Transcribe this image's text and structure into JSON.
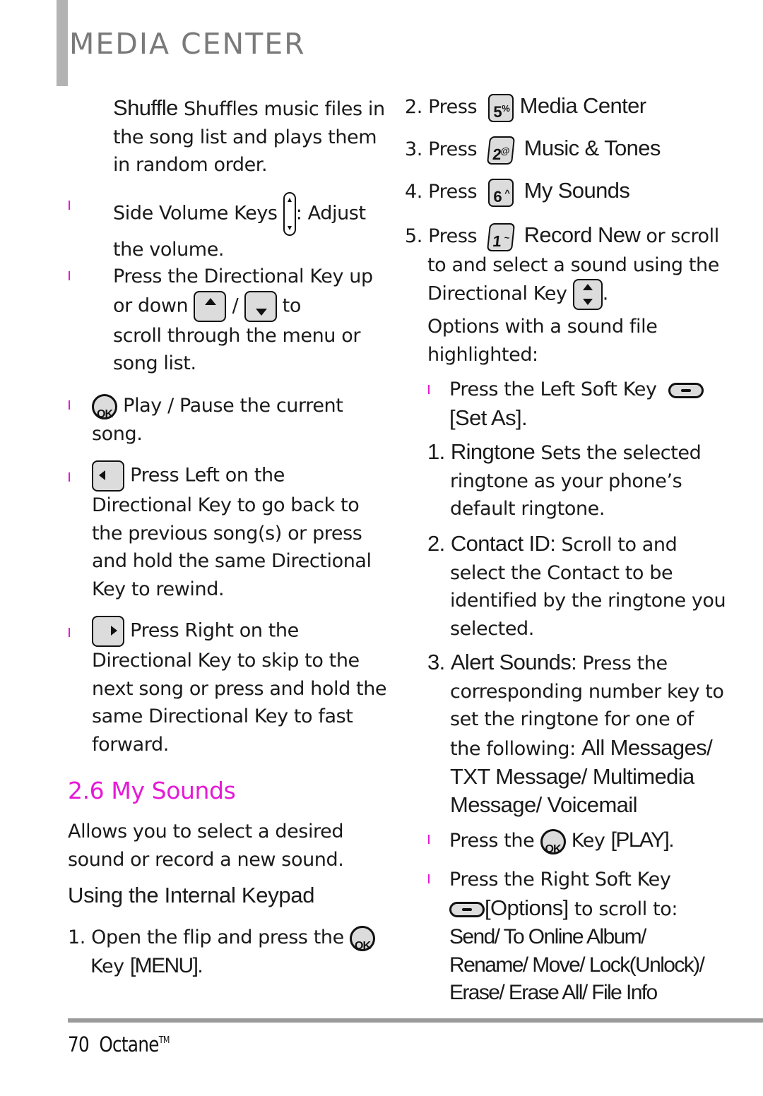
{
  "header": {
    "section_title": "MEDIA CENTER"
  },
  "colors": {
    "accent_pink": "#e619d6",
    "header_gray": "#7a7a7a",
    "rule_gray": "#9a9a9a"
  },
  "left_column": {
    "shuffle": {
      "term": "Shuffle",
      "line1": " Shuffles music files in",
      "line2": "the song list and plays them",
      "line3": "in random order."
    },
    "side_volume": {
      "pre": "Side Volume Keys ",
      "post": ": Adjust",
      "line2": "the volume.",
      "icon": "volume-key-icon"
    },
    "directional": {
      "line1": "Press the Directional Key up",
      "pre2": "or down ",
      "sep": " / ",
      "post2": " to",
      "line3": "scroll through the menu or",
      "line4": "song list.",
      "icons": [
        "up-key-icon",
        "down-key-icon"
      ]
    },
    "play_pause": {
      "icon": "ok-key-icon",
      "ok_label": "OK",
      "line1": " Play / Pause the current",
      "line2": "song."
    },
    "left_key": {
      "icon": "left-key-icon",
      "line1": " Press Left on the",
      "line2": "Directional Key to go back to",
      "line3": "the previous song(s) or press",
      "line4": "and hold the same Directional",
      "line5": "Key to rewind."
    },
    "right_key": {
      "icon": "right-key-icon",
      "line1": " Press Right on the",
      "line2": "Directional Key to skip to the",
      "line3": "next song or press and hold the",
      "line4": "same Directional Key to fast",
      "line5": "forward."
    },
    "my_sounds": {
      "heading": "2.6 My Sounds",
      "desc_line1": "Allows you to select a desired",
      "desc_line2": "sound or record a new sound.",
      "subheading": "Using the Internal Keypad",
      "step1_num": "1.",
      "step1_line1": "Open the flip and press the",
      "step1_key_pre": "Key ",
      "step1_key_label": "[MENU].",
      "ok_label": "OK"
    }
  },
  "right_column": {
    "steps": [
      {
        "num": "2.",
        "press": "Press",
        "key_num": "5",
        "key_sym": "%",
        "label": "Media Center"
      },
      {
        "num": "3.",
        "press": "Press",
        "key_num": "2",
        "key_sym": "@",
        "label": "Music & Tones"
      },
      {
        "num": "4.",
        "press": "Press",
        "key_num": "6",
        "key_sym": "^",
        "label": "My Sounds"
      },
      {
        "num": "5.",
        "press": "Press",
        "key_num": "1",
        "key_sym": "~",
        "label": "Record New",
        "suffix": " or scroll"
      }
    ],
    "step5_line2": "to and select a sound using the",
    "step5_line3": "Directional Key ",
    "step5_end": ".",
    "options_line1": "Options with a sound file",
    "options_line2": "highlighted:",
    "left_soft": {
      "line1": "Press the Left Soft Key ",
      "line2": "[Set As]."
    },
    "set_as_items": [
      {
        "num": "1.",
        "term": "Ringtone",
        "line1": " Sets the selected",
        "line2": "ringtone as your phone’s",
        "line3": "default ringtone."
      },
      {
        "num": "2.",
        "term": "Contact ID:",
        "line1": " Scroll to and",
        "line2": "select the Contact to be",
        "line3": "identified by the ringtone you",
        "line4": "selected."
      },
      {
        "num": "3.",
        "term": "Alert Sounds:",
        "line1": " Press the",
        "line2": "corresponding number key to",
        "line3": "set the ringtone for one of",
        "line4_pre": "the following: ",
        "line4_term": "All Messages/",
        "line5": "TXT Message/ Multimedia",
        "line6": "Message/ Voicemail"
      }
    ],
    "play": {
      "pre": "Press the ",
      "ok_label": "OK",
      "post": " Key ",
      "term": "[PLAY]."
    },
    "right_soft": {
      "line1": "Press the Right Soft Key",
      "options": "[Options]",
      "post": " to scroll to:",
      "line3": "Send/ To Online Album/",
      "line4": "Rename/ Move/ Lock(Unlock)/",
      "line5": "Erase/ Erase All/ File Info"
    }
  },
  "footer": {
    "page_number": "70",
    "product": "Octane",
    "trademark": "TM"
  }
}
